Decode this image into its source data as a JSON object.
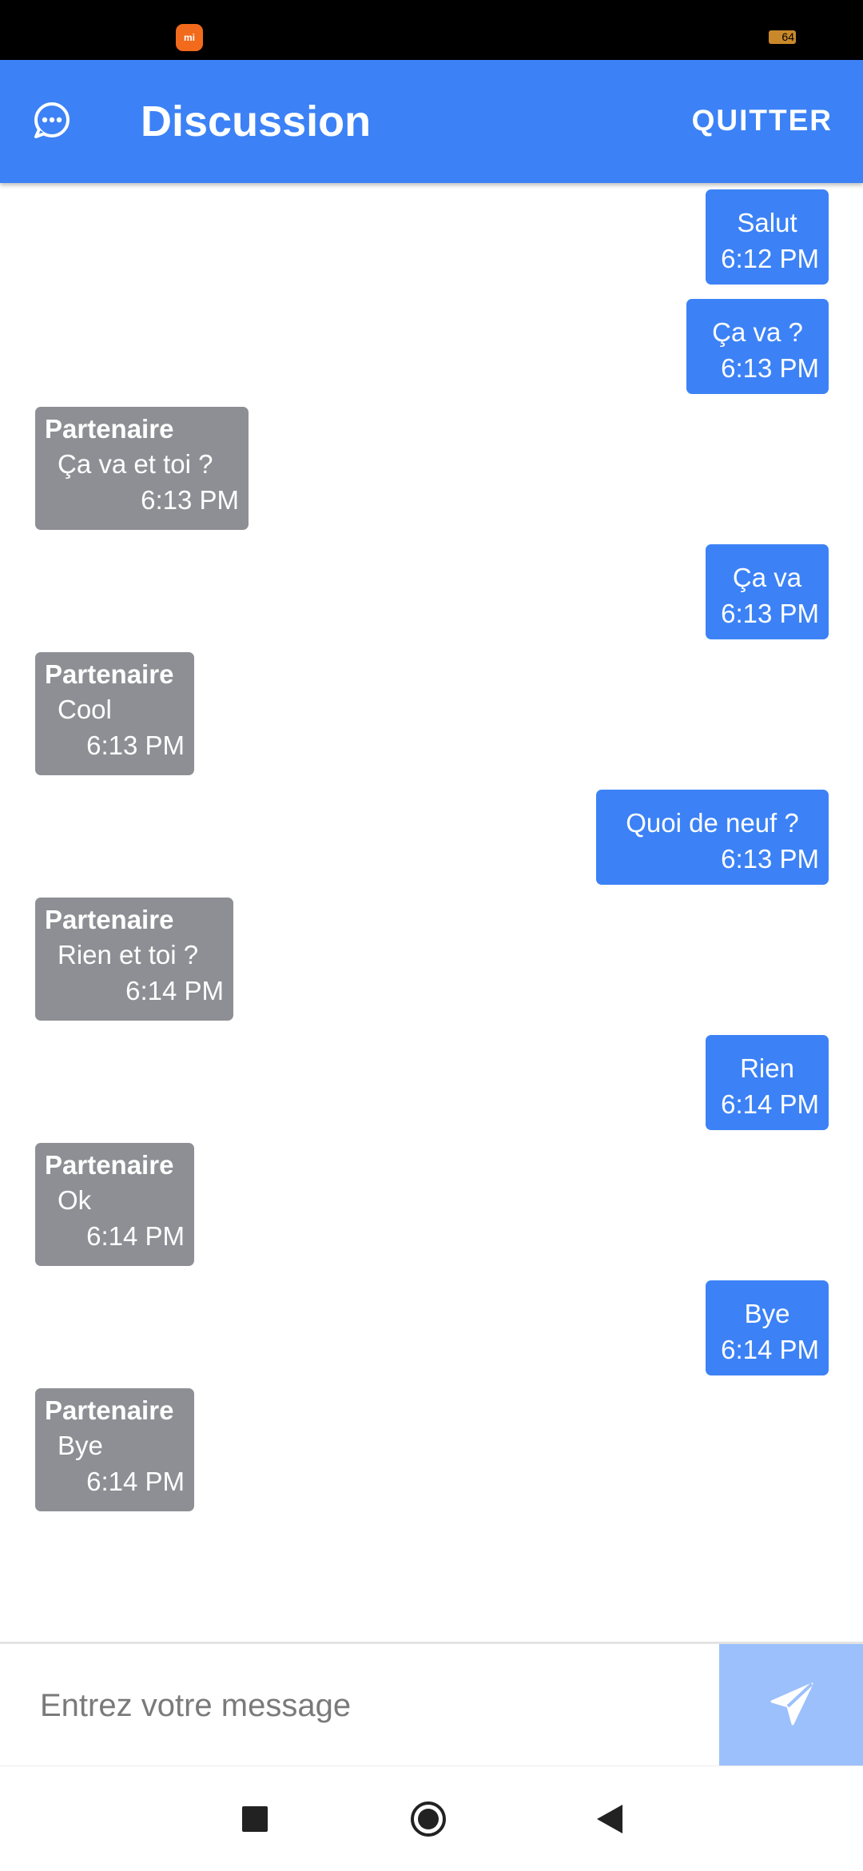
{
  "status_bar": {
    "app_icon": "mi",
    "battery": "64"
  },
  "app_bar": {
    "icon": "chat-bubble-icon",
    "title": "Discussion",
    "quit_label": "QUITTER"
  },
  "messages": [
    {
      "direction": "out",
      "text": "Salut",
      "time": "6:12 PM"
    },
    {
      "direction": "out",
      "text": "Ça va ?",
      "time": "6:13 PM"
    },
    {
      "direction": "in",
      "sender": "Partenaire",
      "text": "Ça va et toi ?",
      "time": "6:13 PM"
    },
    {
      "direction": "out",
      "text": "Ça va",
      "time": "6:13 PM"
    },
    {
      "direction": "in",
      "sender": "Partenaire",
      "text": "Cool",
      "time": "6:13 PM"
    },
    {
      "direction": "out",
      "text": "Quoi de neuf ?",
      "time": "6:13 PM"
    },
    {
      "direction": "in",
      "sender": "Partenaire",
      "text": "Rien et toi ?",
      "time": "6:14 PM"
    },
    {
      "direction": "out",
      "text": "Rien",
      "time": "6:14 PM"
    },
    {
      "direction": "in",
      "sender": "Partenaire",
      "text": "Ok",
      "time": "6:14 PM"
    },
    {
      "direction": "out",
      "text": "Bye",
      "time": "6:14 PM"
    },
    {
      "direction": "in",
      "sender": "Partenaire",
      "text": "Bye",
      "time": "6:14 PM"
    }
  ],
  "composer": {
    "placeholder": "Entrez votre message",
    "value": "",
    "send_icon": "send-icon"
  },
  "nav_bar": {
    "recents_icon": "square-icon",
    "home_icon": "circle-icon",
    "back_icon": "triangle-back-icon"
  },
  "colors": {
    "primary": "#3c82f6",
    "incoming_bubble": "#8e8f94",
    "send_button": "#9cc0fb"
  }
}
